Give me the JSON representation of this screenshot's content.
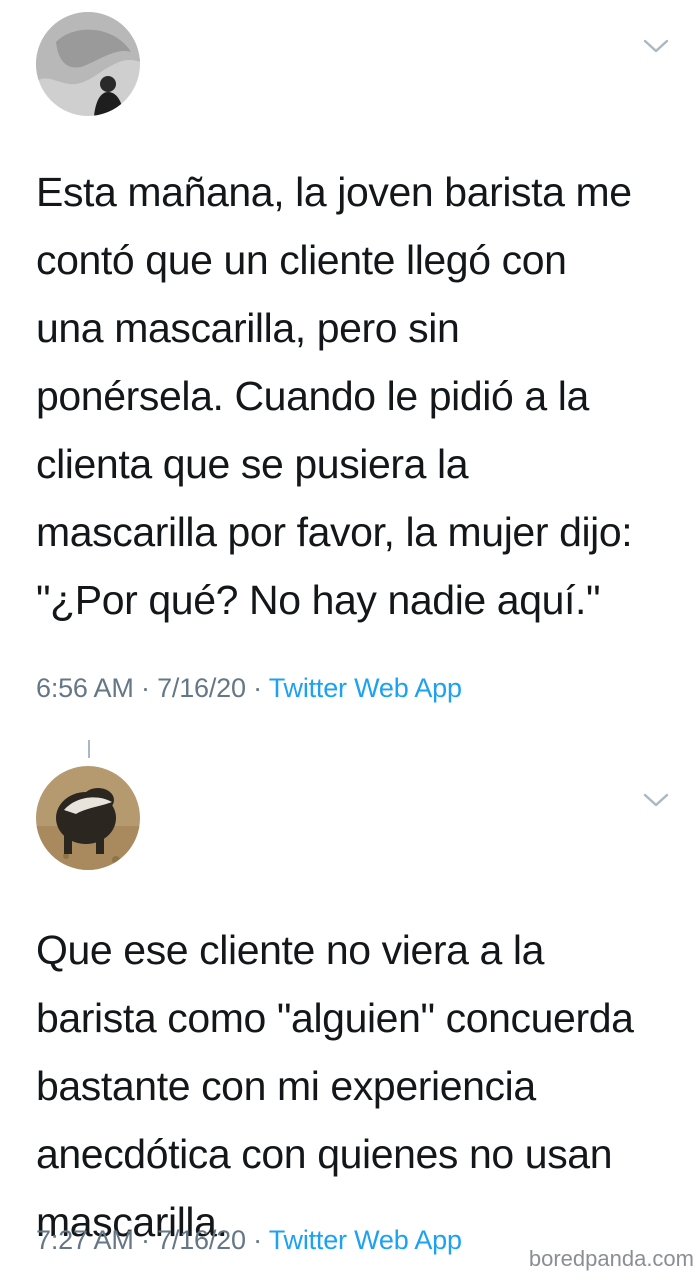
{
  "tweet1": {
    "lines": [
      "Esta mañana, la joven barista me",
      "contó que un cliente llegó con",
      "una mascarilla, pero sin",
      "ponérsela. Cuando le pidió a la",
      "clienta que se pusiera la",
      "mascarilla por favor, la mujer dijo:",
      "\"¿Por qué? No hay nadie aquí.\""
    ],
    "time": "6:56 AM",
    "date": "7/16/20",
    "source": "Twitter Web App",
    "separator": "·",
    "avatar_icon": "avatar-photo-icon",
    "menu_icon": "chevron-down-icon"
  },
  "tweet2": {
    "lines": [
      "Que ese cliente no viera a la",
      "barista como \"alguien\" concuerda",
      "bastante con mi experiencia",
      "anecdótica con quienes no usan",
      "mascarilla."
    ],
    "time": "7:27 AM",
    "date": "7/16/20",
    "source": "Twitter Web App",
    "separator": "·",
    "avatar_icon": "avatar-photo-icon",
    "menu_icon": "chevron-down-icon"
  },
  "watermark": "boredpanda.com",
  "colors": {
    "text": "#14171a",
    "meta": "#657786",
    "link": "#1da1f2",
    "chevron": "#aab8c2"
  }
}
